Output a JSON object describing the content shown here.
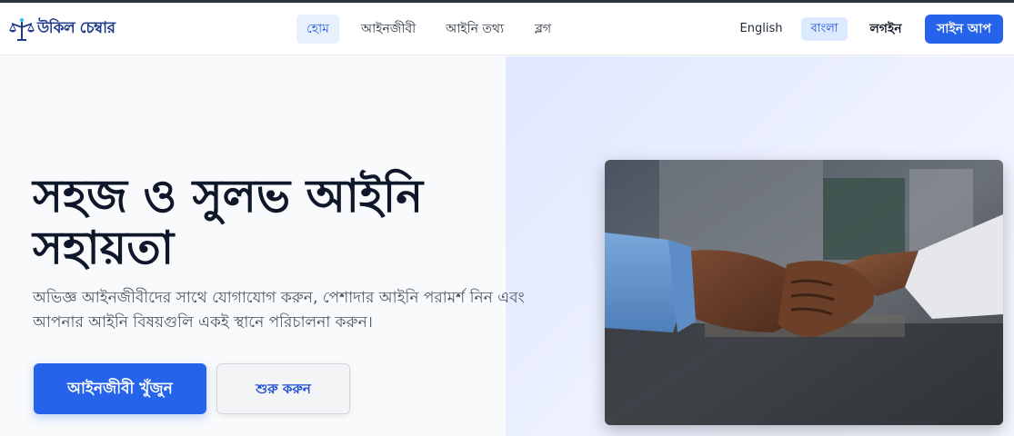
{
  "brand": {
    "name": "উকিল চেম্বার",
    "logo_icon": "scales-of-justice-icon",
    "accent_color": "#2563eb"
  },
  "nav": {
    "links": [
      {
        "label": "হোম",
        "active": true
      },
      {
        "label": "আইনজীবী",
        "active": false
      },
      {
        "label": "আইনি তথ্য",
        "active": false
      },
      {
        "label": "ব্লগ",
        "active": false
      }
    ]
  },
  "language": {
    "options": [
      "English",
      "বাংলা"
    ],
    "selected": "বাংলা"
  },
  "auth": {
    "login_label": "লগইন",
    "signup_label": "সাইন আপ"
  },
  "hero": {
    "title": "সহজ ও সুলভ আইনি সহায়তা",
    "subtitle": "অভিজ্ঞ আইনজীবীদের সাথে যোগাযোগ করুন, পেশাদার আইনি পরামর্শ নিন এবং আপনার আইনি বিষয়গুলি একই স্থানে পরিচালনা করুন।",
    "primary_button": "আইনজীবী খুঁজুন",
    "secondary_button": "শুরু করুন",
    "image": "handshake-photo"
  }
}
